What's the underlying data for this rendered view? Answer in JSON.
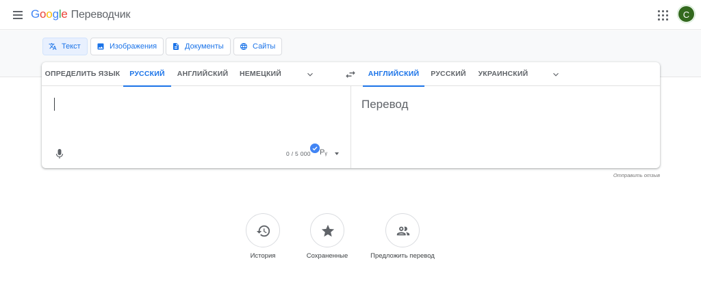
{
  "header": {
    "logo_letters": [
      "G",
      "o",
      "o",
      "g",
      "l",
      "e"
    ],
    "product": "Переводчик",
    "avatar_letter": "C"
  },
  "modes": [
    {
      "label": "Текст",
      "icon": "translate-icon",
      "active": true
    },
    {
      "label": "Изображения",
      "icon": "image-icon",
      "active": false
    },
    {
      "label": "Документы",
      "icon": "document-icon",
      "active": false
    },
    {
      "label": "Сайты",
      "icon": "globe-icon",
      "active": false
    }
  ],
  "source_langs": [
    "ОПРЕДЕЛИТЬ ЯЗЫК",
    "РУССКИЙ",
    "АНГЛИЙСКИЙ",
    "НЕМЕЦКИЙ"
  ],
  "source_active": "РУССКИЙ",
  "target_langs": [
    "АНГЛИЙСКИЙ",
    "РУССКИЙ",
    "УКРАИНСКИЙ"
  ],
  "target_active": "АНГЛИЙСКИЙ",
  "source": {
    "char_count": "0 / 5 000",
    "input_tool": "Pᵧ"
  },
  "target": {
    "placeholder": "Перевод"
  },
  "feedback_link": "Отправить отзыв",
  "actions": [
    {
      "label": "История",
      "icon": "history-icon"
    },
    {
      "label": "Сохраненные",
      "icon": "star-icon"
    },
    {
      "label": "Предложить перевод",
      "icon": "people-icon"
    }
  ],
  "colors": {
    "accent": "#1a73e8",
    "avatar_bg": "#33691e",
    "band": "#f8f9fa"
  }
}
